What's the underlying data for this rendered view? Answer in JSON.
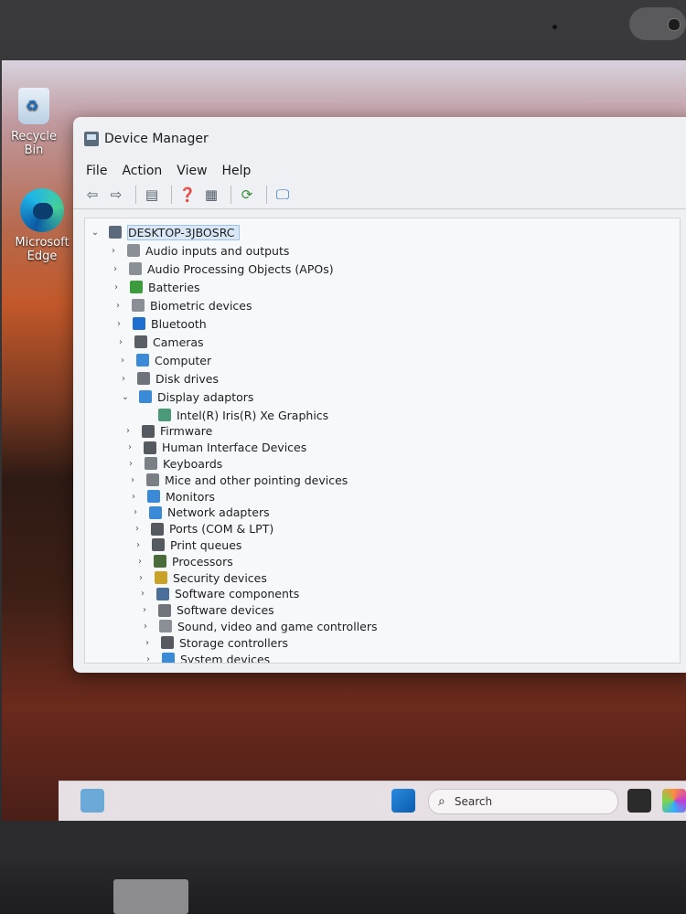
{
  "desktop": {
    "recycle_bin": "Recycle Bin",
    "edge_line1": "Microsoft",
    "edge_line2": "Edge"
  },
  "window": {
    "title": "Device Manager",
    "menu": [
      "File",
      "Action",
      "View",
      "Help"
    ]
  },
  "tree": {
    "root": "DESKTOP-3JBOSRC",
    "items": [
      {
        "label": "Audio inputs and outputs",
        "color": "#8a8f96"
      },
      {
        "label": "Audio Processing Objects (APOs)",
        "color": "#8a8f96"
      },
      {
        "label": "Batteries",
        "color": "#3c9b3c"
      },
      {
        "label": "Biometric devices",
        "color": "#8a8f96"
      },
      {
        "label": "Bluetooth",
        "color": "#1f6fd1"
      },
      {
        "label": "Cameras",
        "color": "#5a5f66"
      },
      {
        "label": "Computer",
        "color": "#3b8ad8"
      },
      {
        "label": "Disk drives",
        "color": "#6f747a"
      },
      {
        "label": "Display adaptors",
        "color": "#3b8ad8",
        "expanded": true
      },
      {
        "label": "Intel(R) Iris(R) Xe Graphics",
        "color": "#4a9a7a",
        "child": true
      },
      {
        "label": "Firmware",
        "color": "#555a60"
      },
      {
        "label": "Human Interface Devices",
        "color": "#555a60"
      },
      {
        "label": "Keyboards",
        "color": "#7a7f86"
      },
      {
        "label": "Mice and other pointing devices",
        "color": "#7a7f86"
      },
      {
        "label": "Monitors",
        "color": "#3b8ad8"
      },
      {
        "label": "Network adapters",
        "color": "#3b8ad8"
      },
      {
        "label": "Ports (COM & LPT)",
        "color": "#555a60"
      },
      {
        "label": "Print queues",
        "color": "#555a60"
      },
      {
        "label": "Processors",
        "color": "#4a6b3a"
      },
      {
        "label": "Security devices",
        "color": "#c9a227"
      },
      {
        "label": "Software components",
        "color": "#4a6f9a"
      },
      {
        "label": "Software devices",
        "color": "#6f747a"
      },
      {
        "label": "Sound, video and game controllers",
        "color": "#8a8f96"
      },
      {
        "label": "Storage controllers",
        "color": "#555a60"
      },
      {
        "label": "System devices",
        "color": "#3b8ad8"
      }
    ]
  },
  "taskbar": {
    "search_placeholder": "Search"
  },
  "colors": {
    "accent": "#1f6fd1",
    "window_bg": "#eef0f3",
    "selection": "#d9e7f7"
  }
}
